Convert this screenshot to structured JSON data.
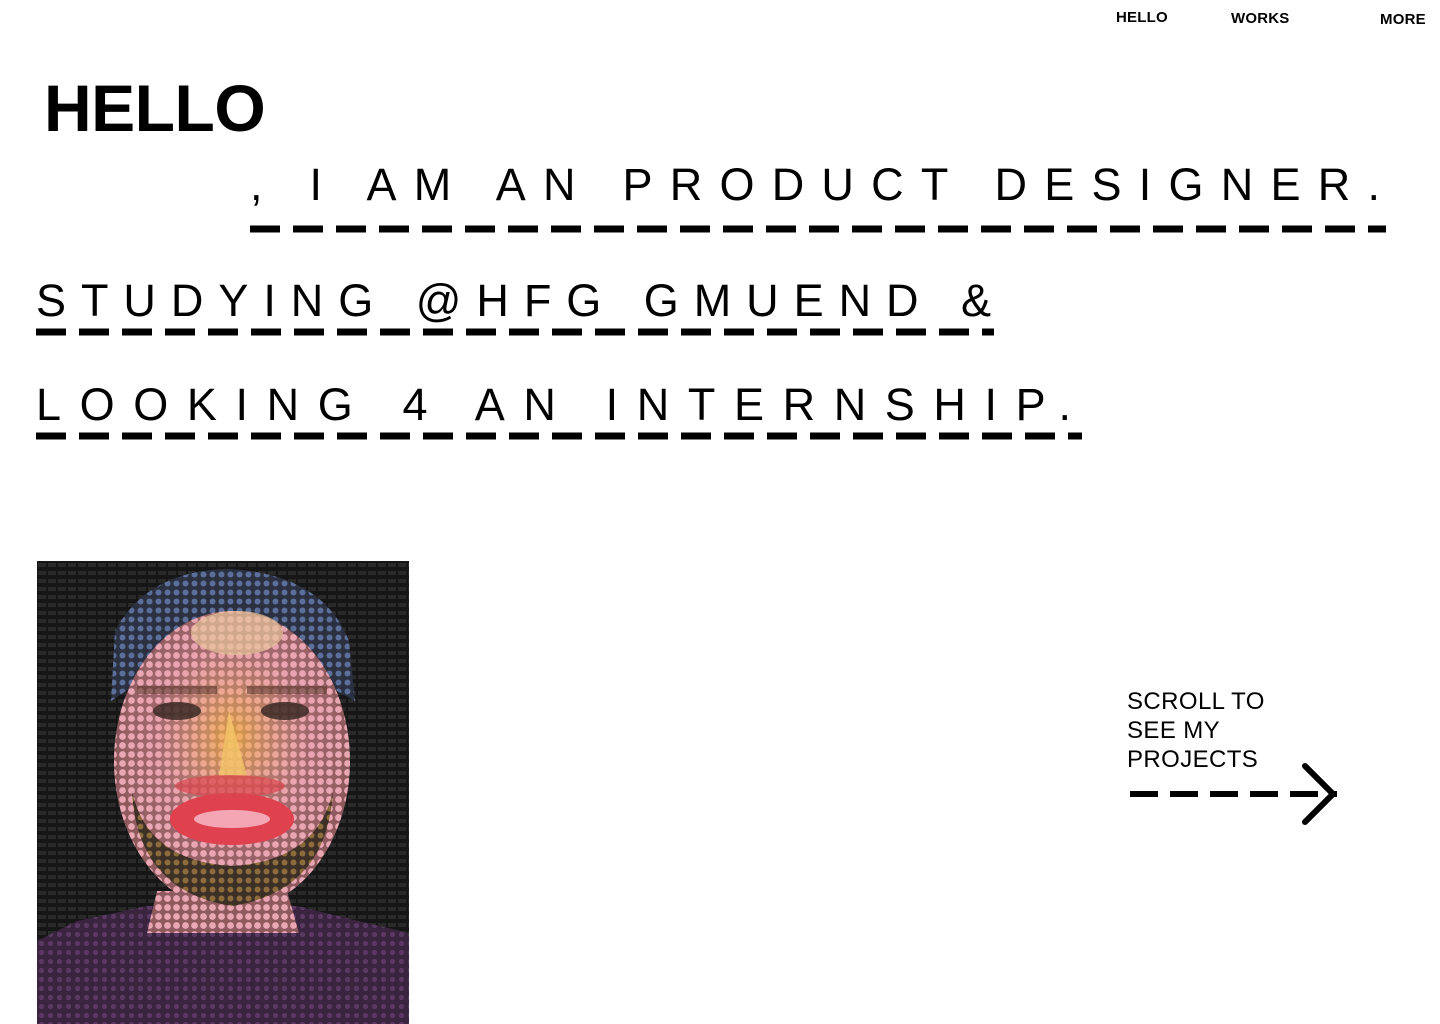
{
  "nav": {
    "hello": "HELLO",
    "works": "WORKS",
    "more": "MORE"
  },
  "hero": {
    "title": "HELLO",
    "lines": [
      ", I AM AN PRODUCT DESIGNER.",
      "STUDYING @HFG GMUEND &",
      "LOOKING 4 AN INTERNSHIP."
    ]
  },
  "cta": {
    "line1": "SCROLL TO",
    "line2": "SEE MY",
    "line3": "PROJECTS",
    "icon": "dashed-arrow-right-icon"
  },
  "portrait": {
    "icon": "emoji-mosaic-portrait"
  },
  "colors": {
    "background": "#ffffff",
    "text": "#000000"
  }
}
